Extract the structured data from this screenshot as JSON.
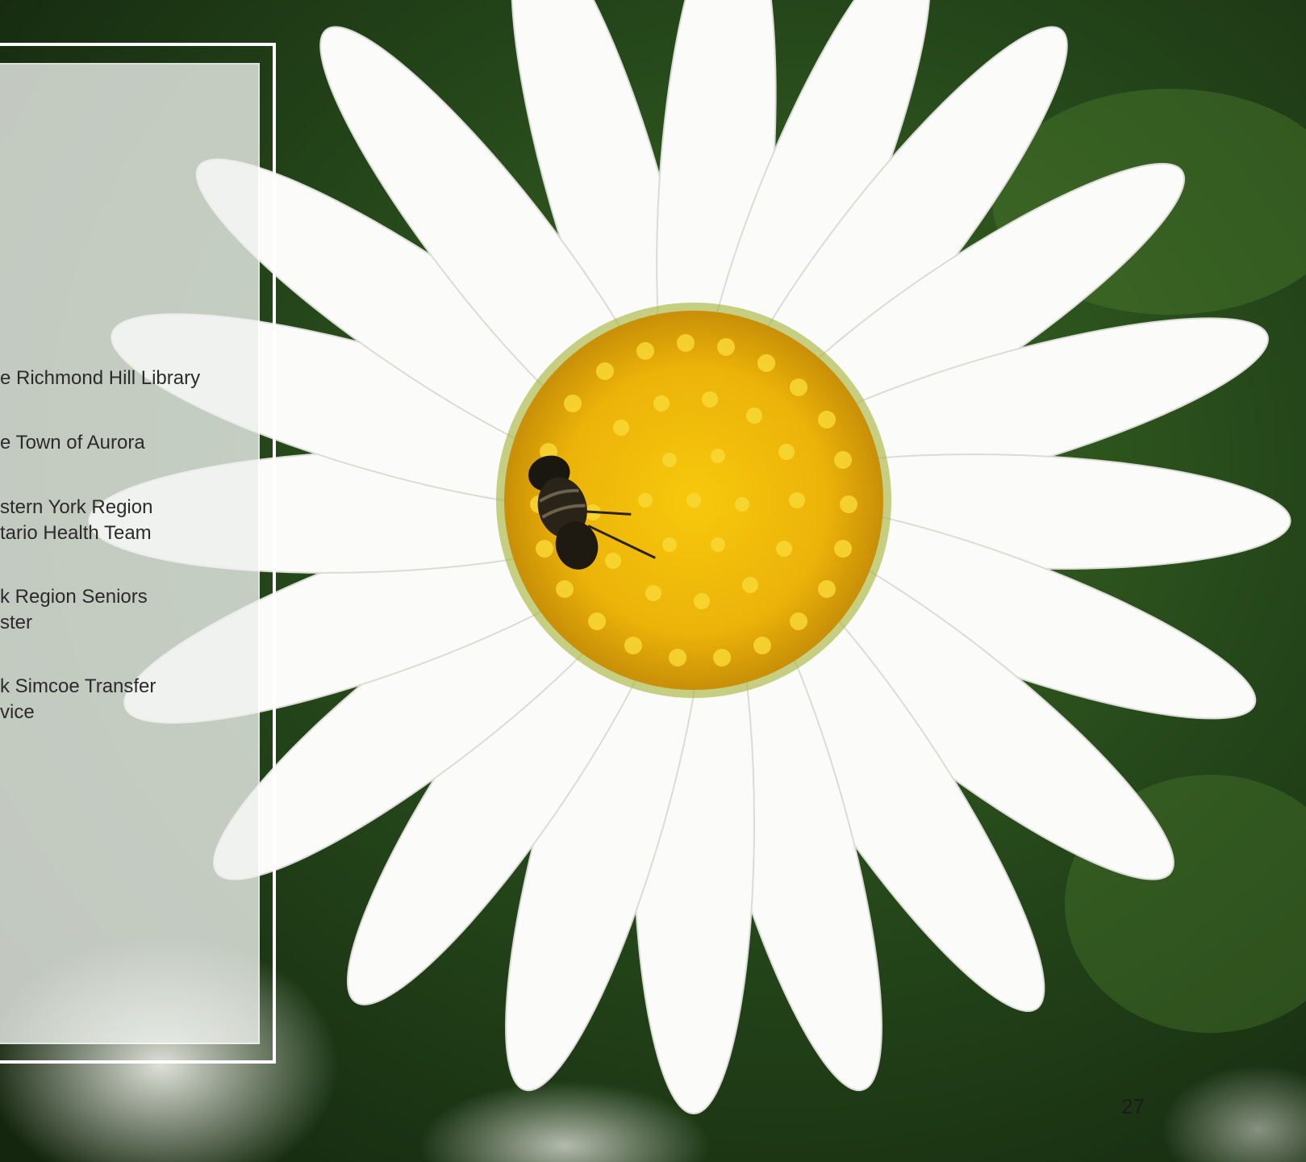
{
  "list": {
    "items": [
      "e Richmond Hill Library",
      "e Town of Aurora",
      "stern York Region\ntario Health Team",
      "k Region Seniors\nster",
      "k Simcoe Transfer\nvice"
    ]
  },
  "page_number": "27",
  "background_photo": "white daisy with yellow center and a bee, green foliage background"
}
